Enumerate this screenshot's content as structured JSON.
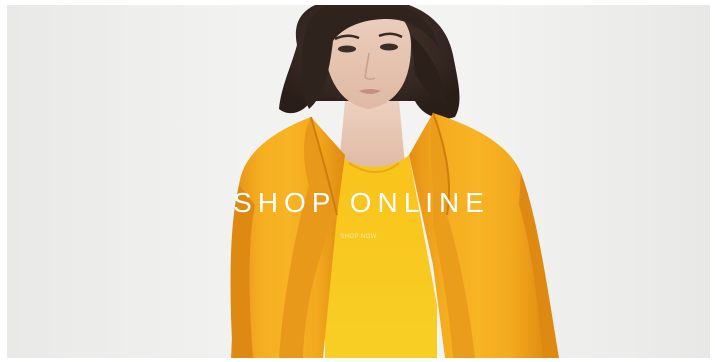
{
  "banner": {
    "headline": "SHOP ONLINE",
    "subline": "SHOP NOW",
    "image_subject": "model-in-yellow-blazer"
  },
  "colors": {
    "background": "#f2f2f1",
    "blazer": "#f2a51c",
    "top": "#f8c91d",
    "hair": "#3a2c26",
    "skin": "#e7c7b3",
    "headline_text": "#ffffff"
  }
}
